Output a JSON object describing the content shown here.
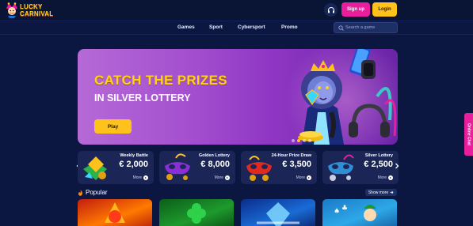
{
  "brand": {
    "line1": "LUCKY",
    "line2": "CARNIVAL"
  },
  "header": {
    "signup_label": "Sign up",
    "login_label": "Login"
  },
  "nav": {
    "items": [
      {
        "label": "Games"
      },
      {
        "label": "Sport"
      },
      {
        "label": "Cybersport"
      },
      {
        "label": "Promo"
      }
    ],
    "search_placeholder": "Search a game"
  },
  "hero": {
    "title_line1": "CATCH THE PRIZES",
    "title_line2": "IN SILVER LOTTERY",
    "play_label": "Play",
    "slides": 4,
    "active_slide": 1
  },
  "lotteries": [
    {
      "name": "Weekly Battle",
      "amount": "€ 2,000",
      "more": "More"
    },
    {
      "name": "Golden Lottery",
      "amount": "€ 8,000",
      "more": "More"
    },
    {
      "name": "24-Hour Prize Draw",
      "amount": "€ 3,500",
      "more": "More"
    },
    {
      "name": "Silver Lottery",
      "amount": "€ 2,500",
      "more": "More"
    }
  ],
  "popular": {
    "title": "Popular",
    "show_more": "Show more"
  },
  "side_chat": {
    "label": "Online Chat"
  },
  "colors": {
    "background": "#0b1740",
    "accent_pink": "#e91e9c",
    "accent_yellow": "#ffc21a",
    "card": "#1b2656"
  },
  "icons": [
    "headset-icon",
    "search-icon",
    "chevron-left-icon",
    "chevron-right-icon",
    "fire-icon",
    "arrow-right-icon"
  ]
}
